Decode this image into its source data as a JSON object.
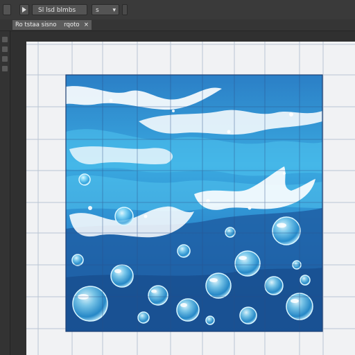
{
  "app": {
    "toolbar": {
      "preset_label": "Sl lsd blmbs",
      "field_label": "s",
      "dropdown_arrow": "▾"
    },
    "document_tab": {
      "label": "Ro tstaa sisno",
      "suffix": "rqoto",
      "close_glyph": "×"
    }
  },
  "artwork": {
    "subject": "ocean waves with bubbles",
    "palette": {
      "deep": "#1c5ea3",
      "mid": "#2f8fd2",
      "light": "#5cc7f0",
      "foam": "#ffffff",
      "canvas_bg": "#f1f2f4",
      "grid_line": "#1f4e8c",
      "ui_dark": "#2f2f2f"
    }
  }
}
